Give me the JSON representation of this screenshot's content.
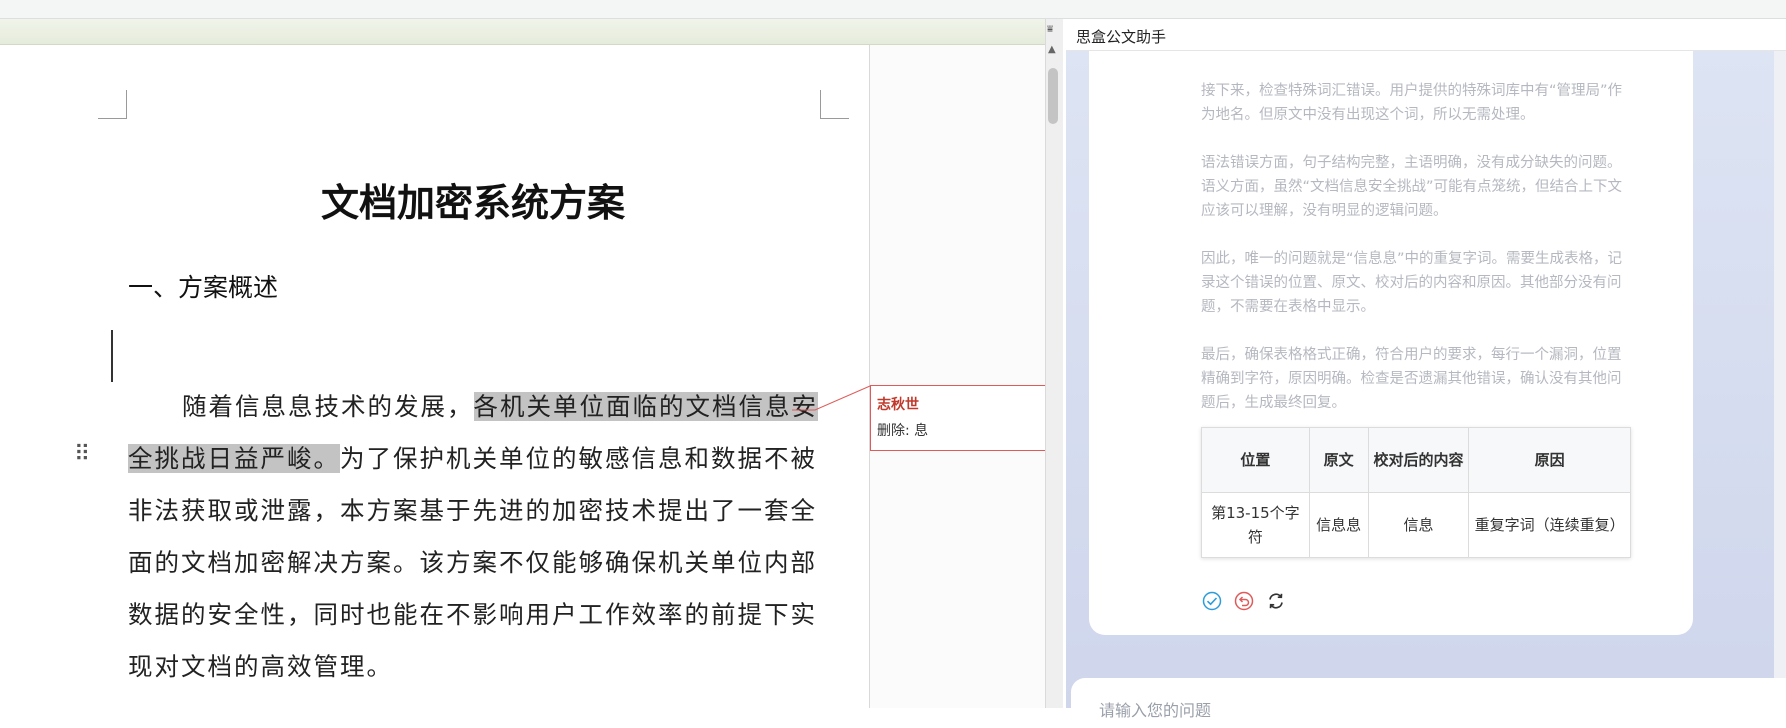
{
  "document": {
    "title": "文档加密系统方案",
    "heading": "一、方案概述",
    "paragraph": {
      "before_highlight": "随着信息息技术的发展，",
      "highlight": "各机关单位面临的文档信息安全挑战日益严峻。",
      "after_highlight": "为了保护机关单位的敏感信息和数据不被非法获取或泄露，本方案基于先进的加密技术提出了一套全面的文档加密解决方案。该方案不仅能够确保机关单位内部数据的安全性，同时也能在不影响用户工作效率的前提下实现对文档的高效管理。"
    }
  },
  "comment": {
    "author": "志秋世",
    "text": "删除: 息"
  },
  "assistant": {
    "title": "思盒公文助手",
    "reasoning": [
      "接下来，检查特殊词汇错误。用户提供的特殊词库中有“管理局”作为地名。但原文中没有出现这个词，所以无需处理。",
      "语法错误方面，句子结构完整，主语明确，没有成分缺失的问题。语义方面，虽然“文档信息安全挑战”可能有点笼统，但结合上下文应该可以理解，没有明显的逻辑问题。",
      "因此，唯一的问题就是“信息息”中的重复字词。需要生成表格，记录这个错误的位置、原文、校对后的内容和原因。其他部分没有问题，不需要在表格中显示。",
      "最后，确保表格格式正确，符合用户的要求，每行一个漏洞，位置精确到字符，原因明确。检查是否遗漏其他错误，确认没有其他问题后，生成最终回复。"
    ],
    "table": {
      "headers": [
        "位置",
        "原文",
        "校对后的内容",
        "原因"
      ],
      "rows": [
        [
          "第13-15个字符",
          "信息息",
          "信息",
          "重复字词（连续重复）"
        ]
      ]
    },
    "actions": [
      "accept-icon",
      "reject-icon",
      "refresh-icon"
    ],
    "input_placeholder": "请输入您的问题"
  },
  "colors": {
    "highlight": "#c3c3c3",
    "comment_accent": "#c0392b",
    "panel_bg": "#d6dcf0",
    "accept": "#2d9cdb",
    "reject": "#e05a5a"
  }
}
